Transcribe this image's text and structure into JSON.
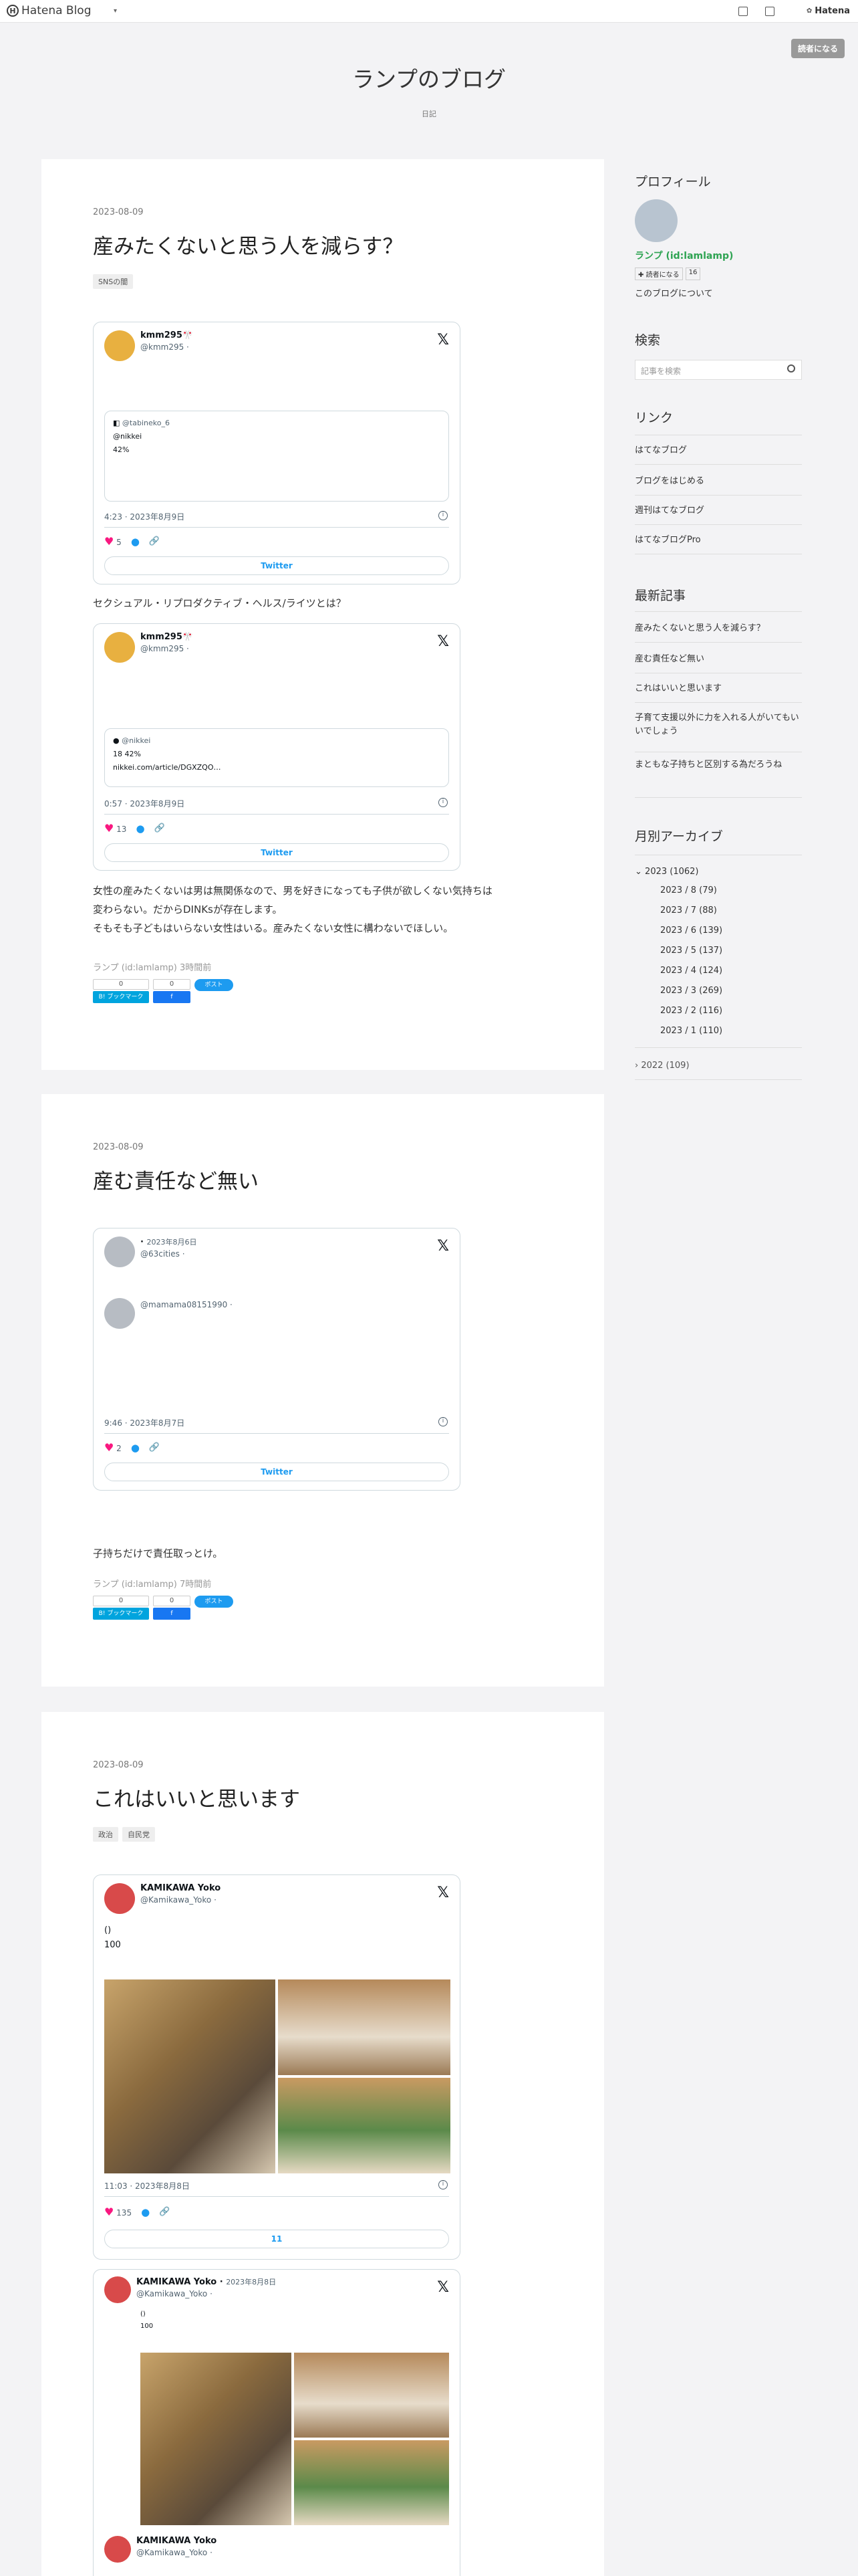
{
  "topbar": {
    "logo": "Hatena Blog",
    "logo_mark": "H",
    "menu": "",
    "write": "",
    "manage": "",
    "readers": "",
    "hatena": "Hatena",
    "reader_button": "読者になる"
  },
  "header": {
    "title": "ランプのブログ",
    "description": "日記"
  },
  "articles": [
    {
      "date": "2023-08-09",
      "title": "産みたくないと思う人を減らす？",
      "categories": [
        "SNSの闇"
      ],
      "tweets": [
        {
          "name": "kmm295🎌",
          "handle": "@kmm295",
          "follow": "",
          "text": "",
          "quote_name": "@tabineko_6",
          "quote_lines": [
            "@nikkei",
            "42%",
            "",
            ""
          ],
          "time": "4:23 · 2023年8月9日",
          "likes": "5",
          "reply": "",
          "copy": "",
          "button": "Twitter"
        },
        {
          "name": "kmm295🎌",
          "handle": "@kmm295",
          "follow": "",
          "text": "",
          "quote_name": "@nikkei",
          "quote_lines": [
            "18 42%",
            "nikkei.com/article/DGXZQO…"
          ],
          "time": "0:57 · 2023年8月9日",
          "likes": "13",
          "reply": "",
          "copy": "",
          "button": "Twitter"
        }
      ],
      "between_text": "セクシュアル・リプロダクティブ・ヘルス/ライツとは？",
      "body": [
        "女性の産みたくないは男は無関係なので、男を好きになっても子供が欲しくない気持ちは",
        "変わらない。だからDINKsが存在します。",
        "そもそも子どもはいらない女性はいる。産みたくない女性に構わないでほしい。"
      ],
      "author": "ランプ (id:lamlamp) 3時間前",
      "hb_count": "0",
      "fb_count": "0",
      "hb_label": "B! ブックマーク",
      "fb_label": "f",
      "tw_label": "ポスト"
    },
    {
      "date": "2023-08-09",
      "title": "産む責任など無い",
      "categories": [],
      "tweets": [
        {
          "name": "",
          "date_inline": "2023年8月6日",
          "handle": "@63cities",
          "follow": "",
          "text": "",
          "reply_name": "",
          "reply_handle": "@mamama08151990",
          "reply_lines": [
            "",
            "",
            "",
            "",
            ""
          ],
          "time": "9:46 · 2023年8月7日",
          "likes": "2",
          "reply": "",
          "copy": "",
          "button": "Twitter"
        }
      ],
      "body": [
        "子持ちだけで責任取っとけ。"
      ],
      "author": "ランプ (id:lamlamp) 7時間前",
      "hb_count": "0",
      "fb_count": "0",
      "hb_label": "B! ブックマーク",
      "fb_label": "f",
      "tw_label": "ポスト"
    },
    {
      "date": "2023-08-09",
      "title": "これはいいと思います",
      "categories": [
        "政治",
        "自民党"
      ],
      "tweets": [
        {
          "name": "KAMIKAWA Yoko",
          "handle": "@Kamikawa_Yoko",
          "follow": "",
          "text_lines": [
            "()",
            "",
            "100"
          ],
          "time": "11:03 · 2023年8月8日",
          "likes": "135",
          "reply": "",
          "copy": "",
          "button": "11"
        },
        {
          "name": "KAMIKAWA Yoko",
          "date_inline": "2023年8月8日",
          "handle": "@Kamikawa_Yoko",
          "follow": "",
          "text_lines": [
            "()",
            "",
            "100"
          ],
          "sub_name": "KAMIKAWA Yoko",
          "sub_handle": "@Kamikawa_Yoko"
        }
      ]
    }
  ],
  "sidebar": {
    "profile_heading": "プロフィール",
    "profile_name": "ランプ (id:lamlamp)",
    "follow_label": "読者になる",
    "follow_count": "16",
    "about_link": "このブログについて",
    "search_heading": "検索",
    "search_placeholder": "記事を検索",
    "links_heading": "リンク",
    "links": [
      "はてなブログ",
      "ブログをはじめる",
      "週刊はてなブログ",
      "はてなブログPro"
    ],
    "recent_heading": "最新記事",
    "recent": [
      "産みたくないと思う人を減らす？",
      "産む責任など無い",
      "これはいいと思います",
      "子育て支援以外に力を入れる人がいてもいいでしょう",
      "まともな子持ちと区別する為だろうね"
    ],
    "archive_heading": "月別アーカイブ",
    "archive_year": "2023 (1062)",
    "archive_months": [
      "2023 / 8 (79)",
      "2023 / 7 (88)",
      "2023 / 6 (139)",
      "2023 / 5 (137)",
      "2023 / 4 (124)",
      "2023 / 3 (269)",
      "2023 / 2 (116)",
      "2023 / 1 (110)"
    ],
    "archive_prev": "2022 (109)"
  }
}
